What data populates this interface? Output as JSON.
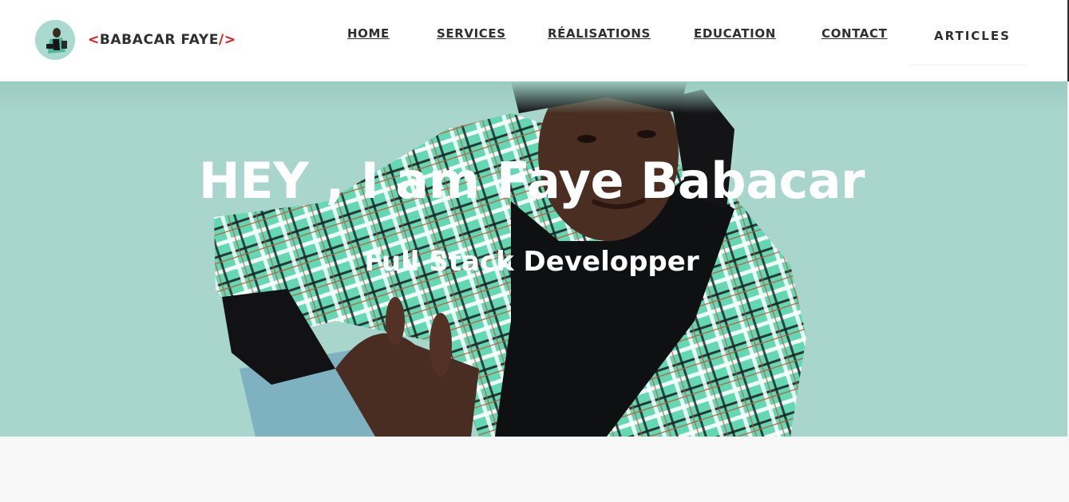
{
  "brand": {
    "open_bracket": "<",
    "name": "BABACAR FAYE",
    "close_bracket": "/>",
    "accent_color": "#e0161b"
  },
  "nav": {
    "items": [
      {
        "label": "HOME"
      },
      {
        "label": "SERVICES"
      },
      {
        "label": "RÉALISATIONS"
      },
      {
        "label": "EDUCATION"
      },
      {
        "label": "CONTACT"
      },
      {
        "label": "ARTICLES"
      }
    ]
  },
  "hero": {
    "title": "HEY , I am Faye Babacar",
    "subtitle": "Full Stack Developper",
    "background_color": "#a8d6cc"
  }
}
